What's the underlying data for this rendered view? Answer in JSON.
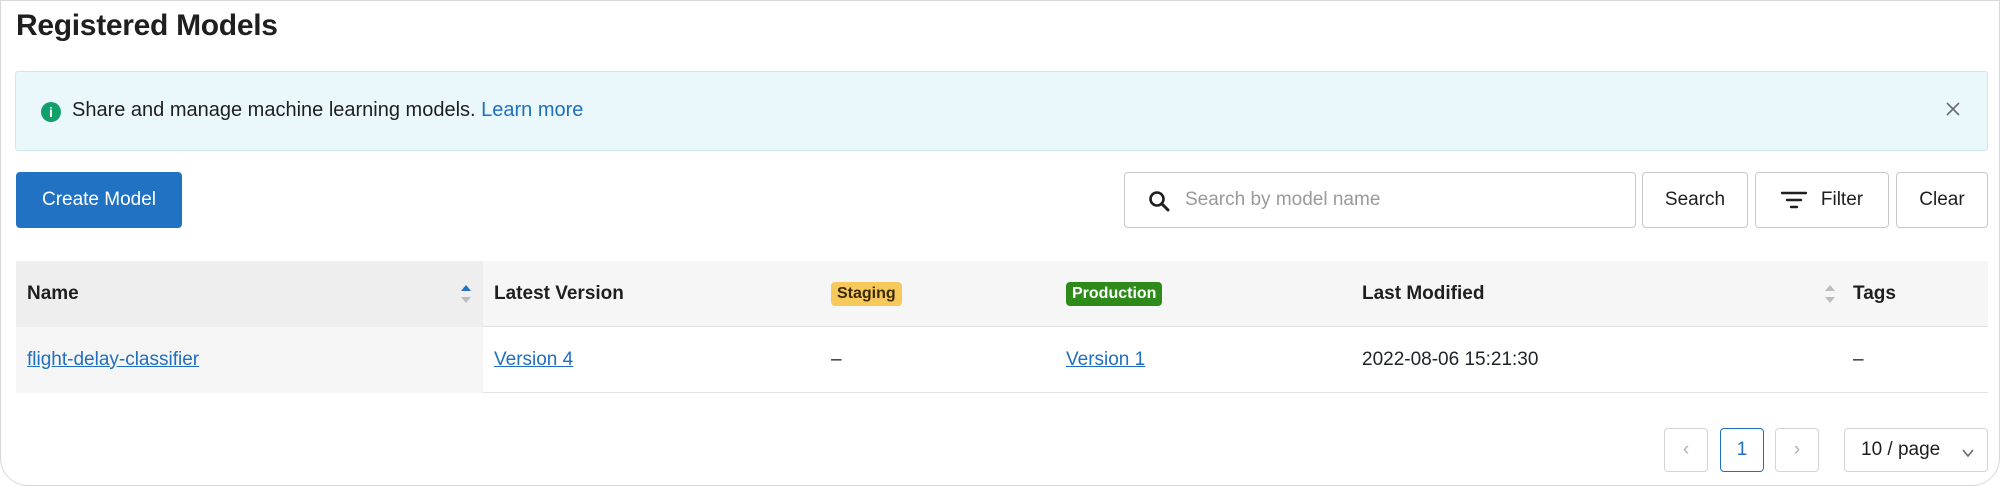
{
  "page": {
    "title": "Registered Models"
  },
  "banner": {
    "text": "Share and manage machine learning models.",
    "link_label": "Learn more",
    "info_glyph": "i",
    "icon": "info-icon",
    "close_icon": "close-icon"
  },
  "toolbar": {
    "create_label": "Create Model",
    "search_placeholder": "Search by model name",
    "search_value": "",
    "search_label": "Search",
    "filter_label": "Filter",
    "clear_label": "Clear"
  },
  "table": {
    "columns": {
      "name": "Name",
      "latest_version": "Latest Version",
      "staging": "Staging",
      "production": "Production",
      "last_modified": "Last Modified",
      "tags": "Tags"
    },
    "rows": [
      {
        "name": "flight-delay-classifier",
        "latest_version": "Version 4",
        "staging": "–",
        "production": "Version 1",
        "last_modified": "2022-08-06 15:21:30",
        "tags": "–"
      }
    ]
  },
  "pagination": {
    "prev_glyph": "‹",
    "current_page": "1",
    "next_glyph": "›",
    "page_size": "10 / page"
  },
  "colors": {
    "primary": "#2272c3",
    "link": "#1f6fbf",
    "staging_badge": "#f7c95c",
    "production_badge": "#2e8a19",
    "banner_bg": "#eaf8fc",
    "info_icon": "#12a06a"
  }
}
